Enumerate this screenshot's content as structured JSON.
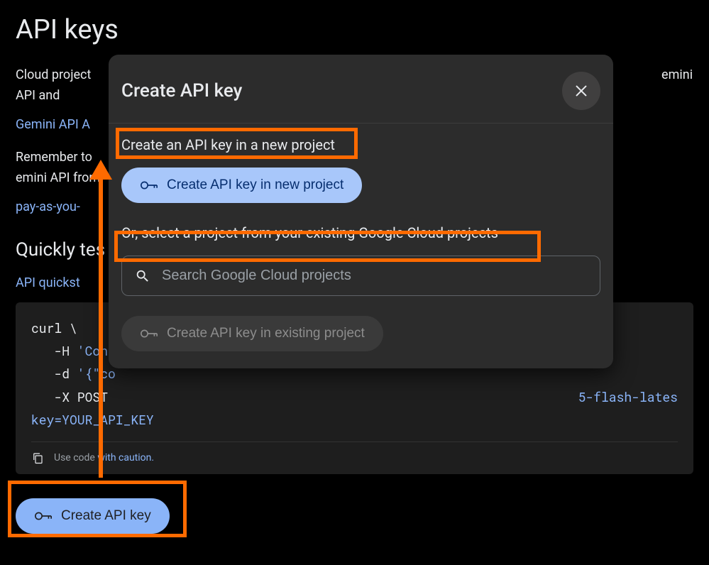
{
  "page": {
    "title": "API keys",
    "desc1_prefix": "Cloud project",
    "desc1_suffix": "emini API and",
    "link1": "Gemini API A",
    "desc2_prefix": "Remember to",
    "desc2_suffix": "emini API from",
    "link2": "pay-as-you-",
    "section_title": "Quickly tes",
    "quickstart_link": "API quickst"
  },
  "code": {
    "l1": "curl \\",
    "l2_a": "   -H ",
    "l2_b": "'Con",
    "l3_a": "   -d ",
    "l3_b": "'{\"co",
    "l4": "   -X POST ",
    "l4_tail": "5-flash-lates",
    "l5": "key=YOUR_API_KEY",
    "caution_pre": "Use code ",
    "caution_link": "with caution."
  },
  "buttons": {
    "create_main": "Create API key"
  },
  "modal": {
    "title": "Create API key",
    "section_new": "Create an API key in a new project",
    "btn_new": "Create API key in new project",
    "section_existing": "Or, select a project from your existing Google Cloud projects",
    "search_placeholder": "Search Google Cloud projects",
    "btn_existing": "Create API key in existing project"
  }
}
